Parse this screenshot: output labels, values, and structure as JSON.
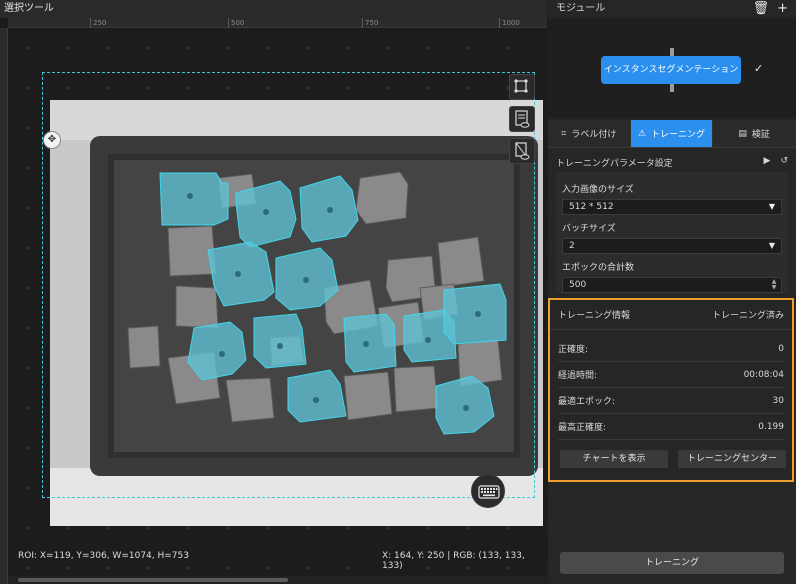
{
  "viewer": {
    "title": "選択ツール",
    "ruler_ticks": [
      "250",
      "500",
      "750",
      "1000"
    ],
    "status_roi": "ROI: X=119, Y=306, W=1074, H=753",
    "status_cursor": "X: 164, Y: 250 | RGB: (133, 133, 133)",
    "tools": [
      "roi-tool-icon",
      "label-view-icon",
      "mask-view-icon"
    ],
    "keyboard_icon": "keyboard-icon"
  },
  "panel": {
    "title": "モジュール",
    "icons": [
      "trash-icon",
      "plus-icon"
    ],
    "module_label": "インスタンスセグメンテーション",
    "tabs": [
      {
        "label": "ラベル付け",
        "icon": "label-icon"
      },
      {
        "label": "トレーニング",
        "icon": "training-icon"
      },
      {
        "label": "検証",
        "icon": "validate-icon"
      }
    ],
    "params_title": "トレーニングパラメータ設定",
    "input_size_label": "入力画像のサイズ",
    "input_size_value": "512 * 512",
    "batch_label": "バッチサイズ",
    "batch_value": "2",
    "epoch_label": "エポックの合計数",
    "epoch_value": "500",
    "info_title": "トレーニング情報",
    "info_status": "トレーニング済み",
    "info_rows": [
      {
        "label": "正確度:",
        "value": "0"
      },
      {
        "label": "経過時間:",
        "value": "00:08:04"
      },
      {
        "label": "最適エポック:",
        "value": "30"
      },
      {
        "label": "最高正確度:",
        "value": "0.199"
      }
    ],
    "show_chart": "チャートを表示",
    "training_center": "トレーニングセンター",
    "train_button": "トレーニング"
  },
  "colors": {
    "accent": "#2b8ff0",
    "highlight": "#f0a030",
    "mask": "#3fc6d8"
  }
}
